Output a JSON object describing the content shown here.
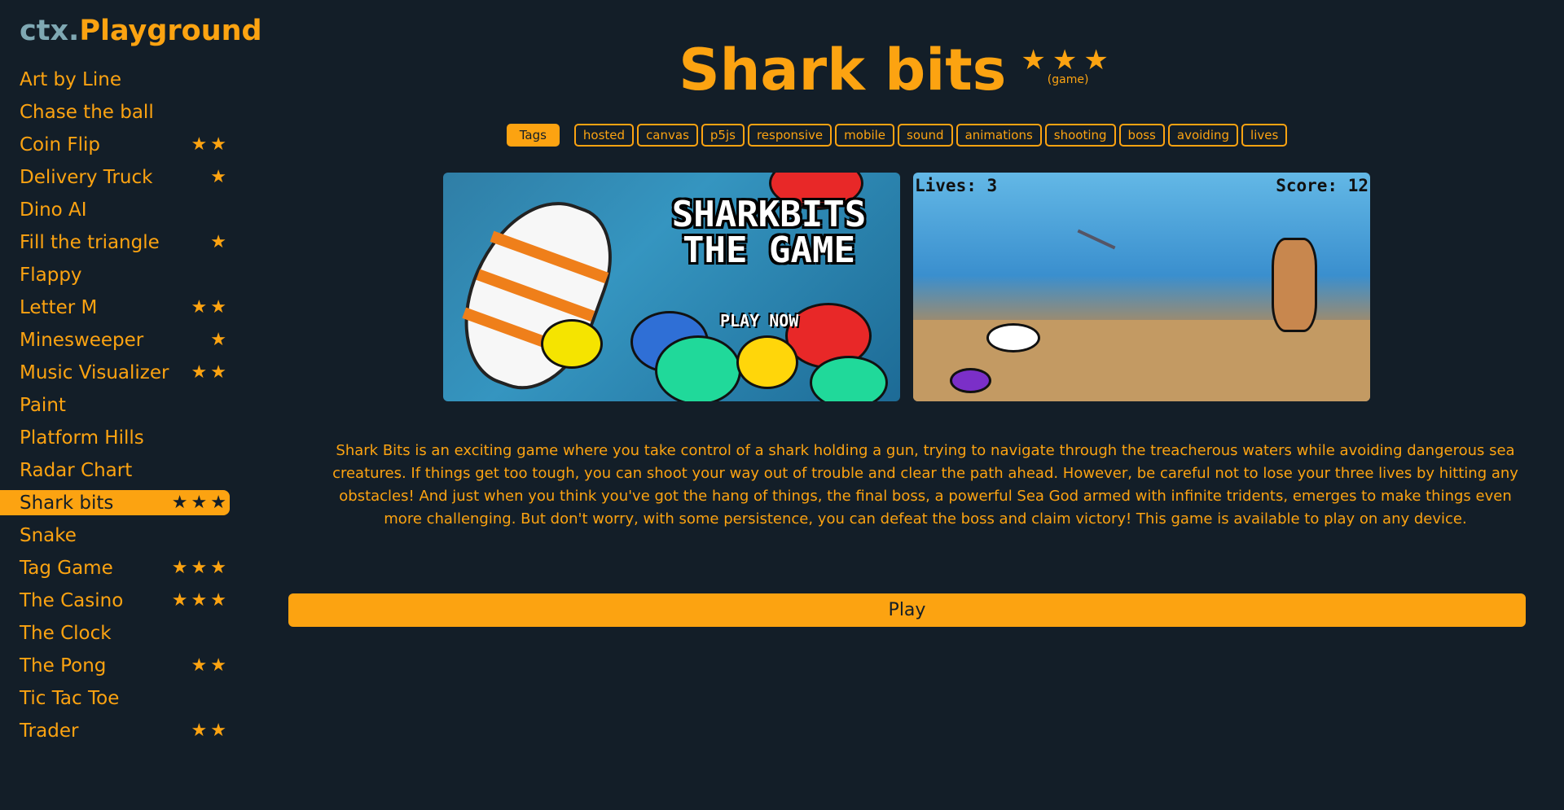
{
  "brand": {
    "prefix": "ctx.",
    "name": "Playground"
  },
  "nav": [
    {
      "label": "Art by Line",
      "stars": 0
    },
    {
      "label": "Chase the ball",
      "stars": 0
    },
    {
      "label": "Coin Flip",
      "stars": 2
    },
    {
      "label": "Delivery Truck",
      "stars": 1
    },
    {
      "label": "Dino AI",
      "stars": 0
    },
    {
      "label": "Fill the triangle",
      "stars": 1
    },
    {
      "label": "Flappy",
      "stars": 0
    },
    {
      "label": "Letter M",
      "stars": 2
    },
    {
      "label": "Minesweeper",
      "stars": 1
    },
    {
      "label": "Music Visualizer",
      "stars": 2
    },
    {
      "label": "Paint",
      "stars": 0
    },
    {
      "label": "Platform Hills",
      "stars": 0
    },
    {
      "label": "Radar Chart",
      "stars": 0
    },
    {
      "label": "Shark bits",
      "stars": 3,
      "active": true
    },
    {
      "label": "Snake",
      "stars": 0
    },
    {
      "label": "Tag Game",
      "stars": 3
    },
    {
      "label": "The Casino",
      "stars": 3
    },
    {
      "label": "The Clock",
      "stars": 0
    },
    {
      "label": "The Pong",
      "stars": 2
    },
    {
      "label": "Tic Tac Toe",
      "stars": 0
    },
    {
      "label": "Trader",
      "stars": 2
    }
  ],
  "page": {
    "title": "Shark bits",
    "rating": 3,
    "kind": "(game)",
    "tags_label": "Tags",
    "tags": [
      "hosted",
      "canvas",
      "p5js",
      "responsive",
      "mobile",
      "sound",
      "animations",
      "shooting",
      "boss",
      "avoiding",
      "lives"
    ],
    "screenshot1": {
      "logo_line1": "SHARKBITS",
      "logo_line2": "THE GAME",
      "play_now": "PLAY NOW"
    },
    "screenshot2": {
      "lives": "Lives: 3",
      "score": "Score: 12"
    },
    "description": "Shark Bits is an exciting game where you take control of a shark holding a gun, trying to navigate through the treacherous waters while avoiding dangerous sea creatures. If things get too tough, you can shoot your way out of trouble and clear the path ahead. However, be careful not to lose your three lives by hitting any obstacles! And just when you think you've got the hang of things, the final boss, a powerful Sea God armed with infinite tridents, emerges to make things even more challenging. But don't worry, with some persistence, you can defeat the boss and claim victory! This game is available to play on any device.",
    "play_label": "Play"
  },
  "colors": {
    "accent": "#fca311",
    "background": "#131e28",
    "brand_prefix": "#7fa8b3"
  }
}
